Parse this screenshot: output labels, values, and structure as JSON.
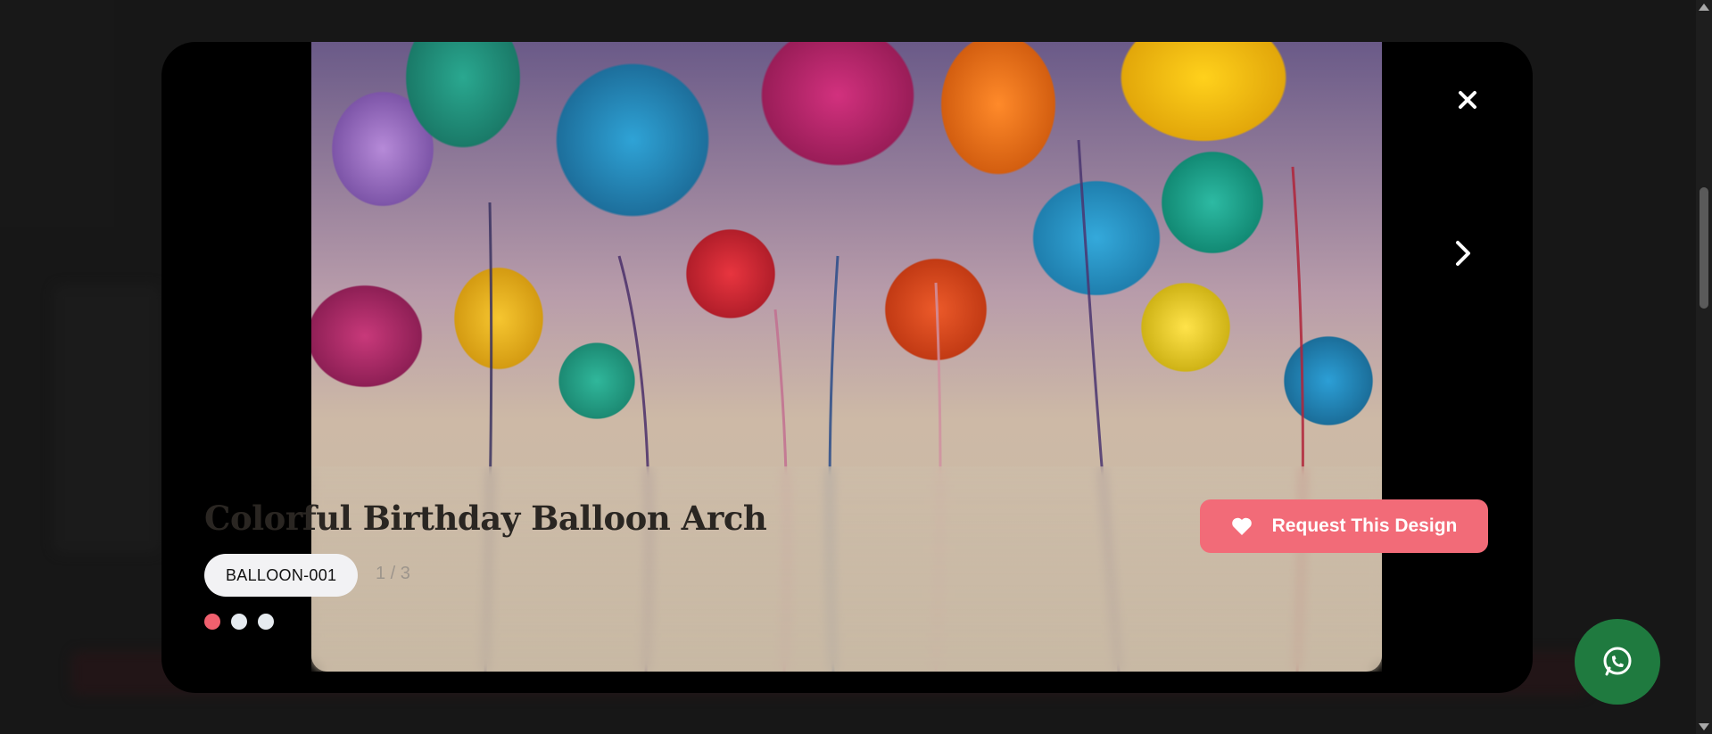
{
  "modal": {
    "title": "Colorful Birthday Balloon Arch",
    "code": "BALLOON-001",
    "counter": "1 / 3",
    "slides_total": 3,
    "active_slide": 1,
    "request_label": "Request This Design",
    "close_icon": "close-icon",
    "next_icon": "chevron-right-icon",
    "request_icon": "heart-icon"
  },
  "floating": {
    "whatsapp_icon": "whatsapp-icon"
  },
  "colors": {
    "accent": "#f26b78",
    "active_dot": "#f0606e",
    "whatsapp_bg": "#1f7a3f",
    "modal_bg": "#000000"
  }
}
